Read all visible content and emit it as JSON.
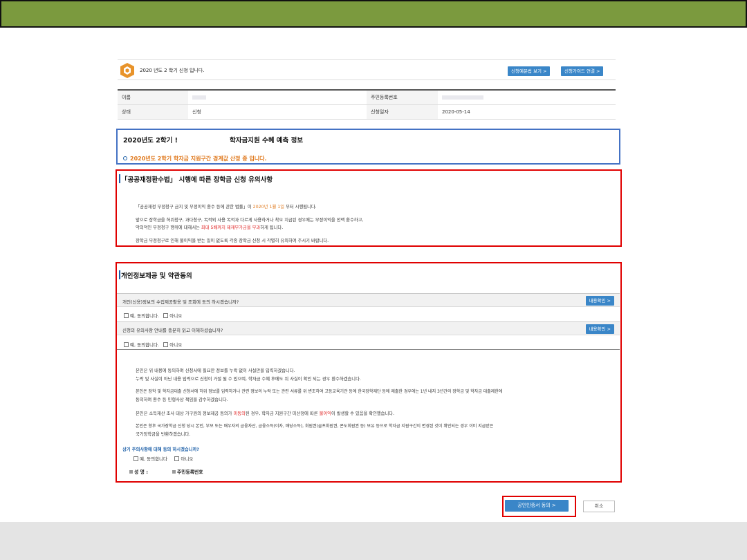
{
  "header": {
    "term_text": "2020 년도 2 학기 신청 입니다.",
    "btn_view_form": "신청예문법 보기 >",
    "btn_guide": "신청가이드 연결 >"
  },
  "info": {
    "name_label": "이름",
    "rrn_label": "주민등록번호",
    "status_label": "상태",
    "status_value": "신청",
    "date_label": "신청일자",
    "date_value": "2020-05-14"
  },
  "forecast": {
    "title_a": "2020년도 2학기 !",
    "title_b": "학자금지원 수혜 예측 정보",
    "status": "2020년도 2학기 학자금 지원구간 경계값 산정 중 입니다."
  },
  "notice": {
    "title": "「공공재정환수법」 시행에 따른 장학금 신청 유의사항",
    "p1_a": "「공공재정 부정청구 금지 및 부정이익 환수 등에 관한 법률」이 ",
    "p1_date": "2020년 1월 1일",
    "p1_b": " 부터 시행됩니다.",
    "p2": "앞으로 장학금을 허위청구, 과다청구, 목적외 사용 목적과 다르게 사용하거나 착오 지급된 경우에는 부정이익을 전액 환수하고,",
    "p3_a": "악의적인 부정청구 행위에 대해서는 ",
    "p3_red": "최대 5배까지 제재부가금을 부과",
    "p3_b": "하게 됩니다.",
    "p4": "장학금 부정청구로 인해 불이익을 받는 일이 없도록 각종 장학금 신청 시 각별히 유의하여 주시기 바랍니다."
  },
  "consent": {
    "title": "개인정보제공 및 약관동의",
    "q1": "개인(신용)정보의 수집제공활용 및 조회에 동의 하시겠습니까?",
    "q2": "신청의 유의사항 안내를 충분히 읽고 이해하셨습니까?",
    "detail_btn": "내용확인 >",
    "yes": "예, 동의합니다.",
    "no": "아니오",
    "l1": "본인은 위 내용에 동의하며 신청서에 필요한 정보를 누락 없이 사실만을 입력하겠습니다.",
    "l2": "누락 및 사실이 아닌 내용 입력으로 신청이 거절 될 수 있으며, 학자금 수혜 후에도 위 사실이 확인 되는 경우 환수하겠습니다.",
    "l3": "본인은 장학 및 학자금대출 신청서에 허위 정보를 입력하거나 관련 정보의 누락 또는 관련 서류를 위 변조하여 고등교육기관 등에 한국장학재단 등에 제출한 경우에는 1년 내지 3년간의 장학금 및 학자금 대출제한에",
    "l4": "동의하며 환수 등 민형사상 책임을 감수하겠습니다.",
    "l5_a": "본인은 소득재산 조사 대상 가구원의 정보제공 동의가 ",
    "l5_red": "미동의",
    "l5_b": "된 경우, 학자금 지원구간 미산정에 따른 ",
    "l5_red2": "불이익",
    "l5_c": "이 발생할 수 있음을 확인했습니다.",
    "l6": "본인은 향후 국가장학금 신청 당시 본인, 부모 또는 배우자의 금융자산, 금융소득(이자, 배당소득), 회원권(골프회원권, 콘도회원권 등) 보유 등으로 학자금 지원구간이 변경된 것이 확인되는 경우 이미 지급받은",
    "l7": "국가장학금을 반환하겠습니다.",
    "q3": "상기 주의사항에 대해 동의 하시겠습니까?",
    "yes2": "예, 동의합니다",
    "sig_name": "성 명 :",
    "sig_rrn": "주민등록번호"
  },
  "actions": {
    "cert_agree": "공인인증서 동의 >",
    "cancel": "취소"
  }
}
